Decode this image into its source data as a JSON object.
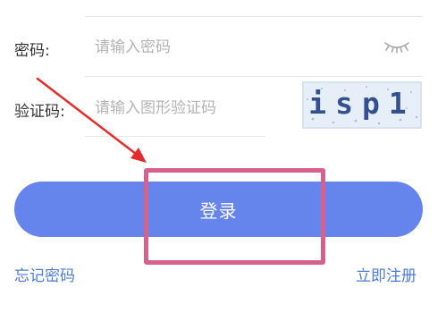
{
  "form": {
    "password_label": "密码:",
    "password_placeholder": "请输入密码",
    "captcha_label": "验证码:",
    "captcha_placeholder": "请输入图形验证码",
    "captcha_text": "isp1"
  },
  "actions": {
    "login_label": "登录",
    "forgot_password": "忘记密码",
    "register_now": "立即注册"
  },
  "colors": {
    "primary_button": "#6685ec",
    "link": "#4d7bd6",
    "highlight": "#d8608d",
    "arrow": "#e52b2b"
  }
}
